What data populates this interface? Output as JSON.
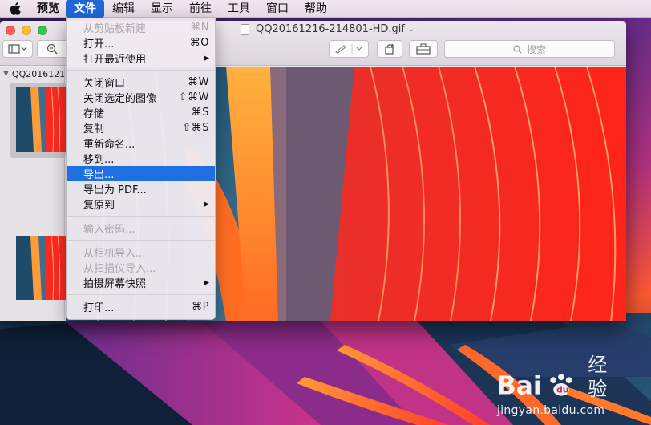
{
  "menubar": {
    "apple_icon": "apple-logo-icon",
    "items": [
      {
        "label": "预览"
      },
      {
        "label": "文件"
      },
      {
        "label": "编辑"
      },
      {
        "label": "显示"
      },
      {
        "label": "前往"
      },
      {
        "label": "工具"
      },
      {
        "label": "窗口"
      },
      {
        "label": "帮助"
      }
    ]
  },
  "window": {
    "title": "QQ20161216-214801-HD.gif",
    "search_placeholder": "搜索",
    "sidebar_header": "QQ2016121",
    "thumbnails": 2
  },
  "file_menu": {
    "items": [
      {
        "label": "从剪贴板新建",
        "shortcut": "⌘N",
        "disabled": true
      },
      {
        "label": "打开...",
        "shortcut": "⌘O"
      },
      {
        "label": "打开最近使用",
        "submenu": true
      },
      {
        "label": "关闭窗口",
        "shortcut": "⌘W"
      },
      {
        "label": "关闭选定的图像",
        "shortcut": "⇧⌘W"
      },
      {
        "label": "存储",
        "shortcut": "⌘S"
      },
      {
        "label": "复制",
        "shortcut": "⇧⌘S"
      },
      {
        "label": "重新命名..."
      },
      {
        "label": "移到..."
      },
      {
        "label": "导出...",
        "highlighted": true
      },
      {
        "label": "导出为 PDF..."
      },
      {
        "label": "复原到",
        "submenu": true
      },
      {
        "label": "输入密码...",
        "disabled": true
      },
      {
        "label": "从相机导入...",
        "disabled": true
      },
      {
        "label": "从扫描仪导入...",
        "disabled": true
      },
      {
        "label": "拍摄屏幕快照",
        "submenu": true
      },
      {
        "label": "打印...",
        "shortcut": "⌘P"
      }
    ]
  },
  "watermark": {
    "logo": "Bai 经验",
    "url": "jingyan.baidu.com"
  },
  "colors": {
    "menu_highlight": "#1f6fe0",
    "close": "#fc5f57",
    "minimize": "#fdbc2e",
    "maximize": "#34c84a"
  }
}
